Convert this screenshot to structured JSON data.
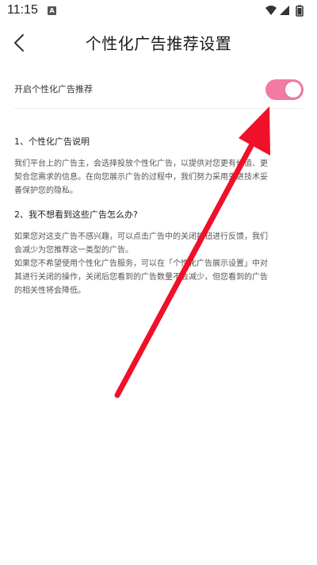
{
  "status_bar": {
    "time": "11:15",
    "app_icon_letter": "A",
    "icons": [
      "wifi-icon",
      "cellular-signal-icon",
      "battery-icon"
    ]
  },
  "header": {
    "back_icon": "chevron-left-icon",
    "title": "个性化广告推荐设置"
  },
  "setting": {
    "label": "开启个性化广告推荐",
    "enabled": true,
    "accent_color": "#f27aa3"
  },
  "sections": [
    {
      "heading": "1、个性化广告说明",
      "body": "我们平台上的广告主，会选择投放个性化广告，以提供对您更有价值、更\n契合您需求的信息。在向您展示广告的过程中，我们努力采用先进技术妥\n善保护您的隐私。"
    },
    {
      "heading": "2、我不想看到这些广告怎么办?",
      "body": "如果您对这支广告不感兴趣，可以点击广告中的关闭按钮进行反馈，我们\n会减少为您推荐这一类型的广告。\n 如果您不希望使用个性化广告服务，可以在「个性化广告展示设置」中对\n其进行关闭的操作，关闭后您看到的广告数量不会减少，但您看到的广告\n的相关性将会降低。"
    }
  ],
  "annotation": {
    "type": "red-arrow-icon",
    "color": "#f0102a"
  }
}
